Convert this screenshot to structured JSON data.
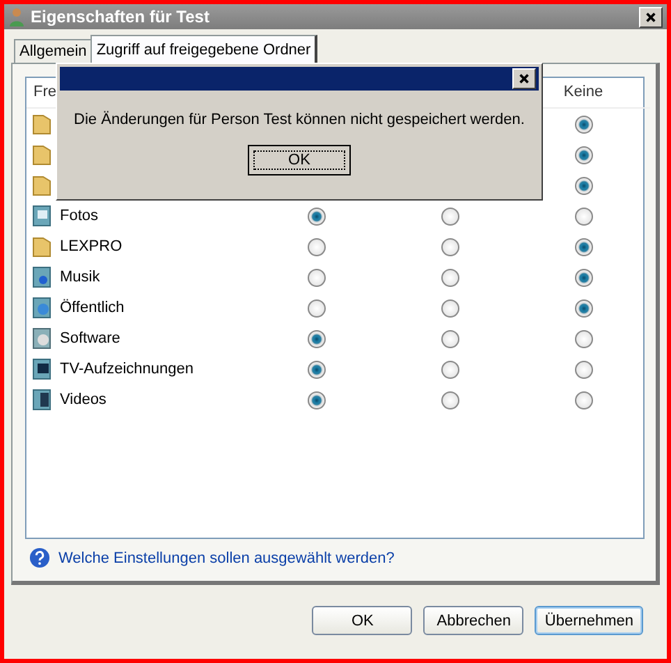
{
  "window": {
    "title": "Eigenschaften für Test"
  },
  "tabs": [
    {
      "label": "Allgemein",
      "selected": false
    },
    {
      "label": "Zugriff auf freigegebene Ordner",
      "selected": true
    }
  ],
  "list": {
    "header_first": "Fre",
    "header_last": "Keine",
    "rows": [
      {
        "kind": "folder",
        "radios": [
          {
            "selected": true
          }
        ]
      },
      {
        "kind": "folder",
        "radios": [
          {
            "selected": true
          }
        ]
      },
      {
        "kind": "folder",
        "radios": [
          {
            "selected": true
          }
        ]
      },
      {
        "kind": "pictures",
        "name": "Fotos",
        "radios": [
          {
            "selected": true
          },
          {
            "selected": false
          },
          {
            "selected": false
          }
        ]
      },
      {
        "kind": "folder",
        "name": "LEXPRO",
        "radios": [
          {
            "selected": false
          },
          {
            "selected": false
          },
          {
            "selected": true
          }
        ]
      },
      {
        "kind": "music",
        "name": "Musik",
        "radios": [
          {
            "selected": false
          },
          {
            "selected": false
          },
          {
            "selected": true
          }
        ]
      },
      {
        "kind": "public",
        "name": "Öffentlich",
        "radios": [
          {
            "selected": false
          },
          {
            "selected": false
          },
          {
            "selected": true
          }
        ]
      },
      {
        "kind": "software",
        "name": "Software",
        "radios": [
          {
            "selected": true
          },
          {
            "selected": false
          },
          {
            "selected": false
          }
        ]
      },
      {
        "kind": "tv",
        "name": "TV-Aufzeichnungen",
        "radios": [
          {
            "selected": true
          },
          {
            "selected": false
          },
          {
            "selected": false
          }
        ]
      },
      {
        "kind": "video",
        "name": "Videos",
        "radios": [
          {
            "selected": true
          },
          {
            "selected": false
          },
          {
            "selected": false
          }
        ]
      }
    ]
  },
  "help_link": "Welche Einstellungen sollen ausgewählt werden?",
  "buttons": [
    {
      "label": "OK",
      "default": false
    },
    {
      "label": "Abbrechen",
      "default": false
    },
    {
      "label": "Übernehmen",
      "default": true
    }
  ],
  "message_box": {
    "text": "Die Änderungen für Person Test können nicht gespeichert werden.",
    "button": "OK"
  }
}
